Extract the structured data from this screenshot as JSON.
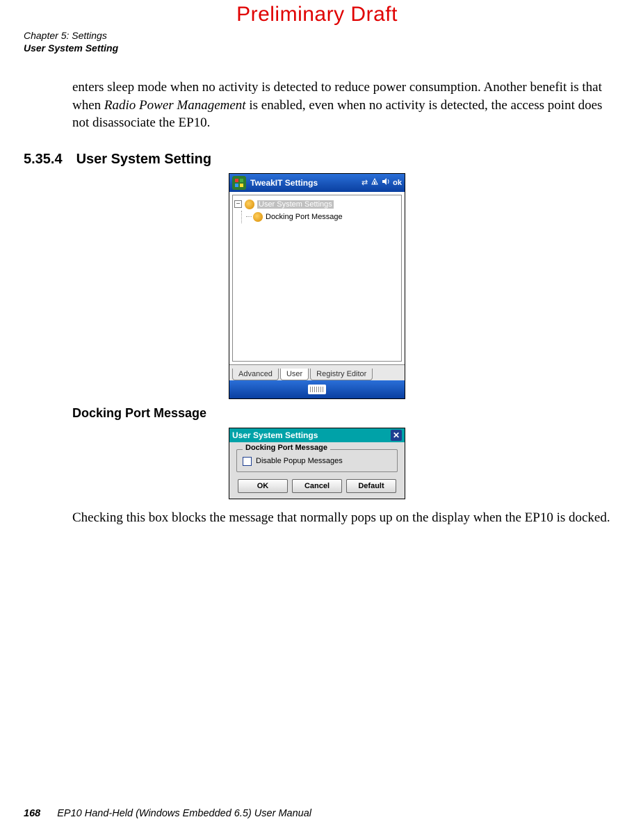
{
  "watermark": "Preliminary Draft",
  "header": {
    "chapter_line": "Chapter 5: Settings",
    "section_line": "User System Setting"
  },
  "intro_para": {
    "p1": "enters sleep mode when no activity is detected to reduce power consumption. Another benefit is that when ",
    "ital": "Radio Power Management",
    "p2": " is enabled, even when no activity is detected, the access point does not disassociate the EP10."
  },
  "section": {
    "number": "5.35.4",
    "title": "User System Setting"
  },
  "screenshot1": {
    "window_title": "TweakIT Settings",
    "status_icons": {
      "conn": "⇄",
      "signal": "▮▯▮",
      "volume": "🔊",
      "ok": "ok"
    },
    "tree": {
      "root": "User System Settings",
      "child": "Docking Port Message"
    },
    "tabs": [
      "Advanced",
      "User",
      "Registry Editor"
    ],
    "active_tab_index": 1
  },
  "subhead": "Docking Port Message",
  "screenshot2": {
    "window_title": "User System Settings",
    "group_title": "Docking Port Message",
    "checkbox_label": "Disable Popup Messages",
    "buttons": {
      "ok": "OK",
      "cancel": "Cancel",
      "default": "Default"
    }
  },
  "closing_para": "Checking this box blocks the message that normally pops up on the display when the EP10 is docked.",
  "footer": {
    "page_number": "168",
    "manual_title": "EP10 Hand-Held (Windows Embedded 6.5) User Manual"
  }
}
